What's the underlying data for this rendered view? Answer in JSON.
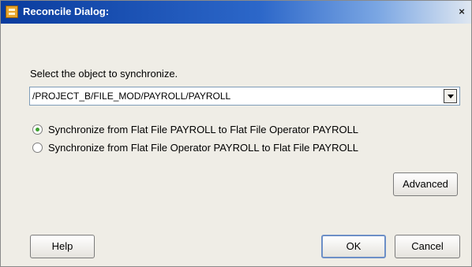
{
  "window": {
    "title": "Reconcile Dialog:",
    "close_glyph": "×"
  },
  "prompt": "Select the object to synchronize.",
  "combo": {
    "selected": "/PROJECT_B/FILE_MOD/PAYROLL/PAYROLL"
  },
  "radios": [
    {
      "label": "Synchronize from Flat File PAYROLL to Flat File Operator PAYROLL",
      "checked": true
    },
    {
      "label": "Synchronize from Flat File Operator PAYROLL to Flat File PAYROLL",
      "checked": false
    }
  ],
  "buttons": {
    "advanced": "Advanced",
    "help": "Help",
    "ok": "OK",
    "cancel": "Cancel"
  },
  "icons": {
    "app": "app-icon",
    "close": "close-icon",
    "dropdown": "chevron-down-icon"
  }
}
